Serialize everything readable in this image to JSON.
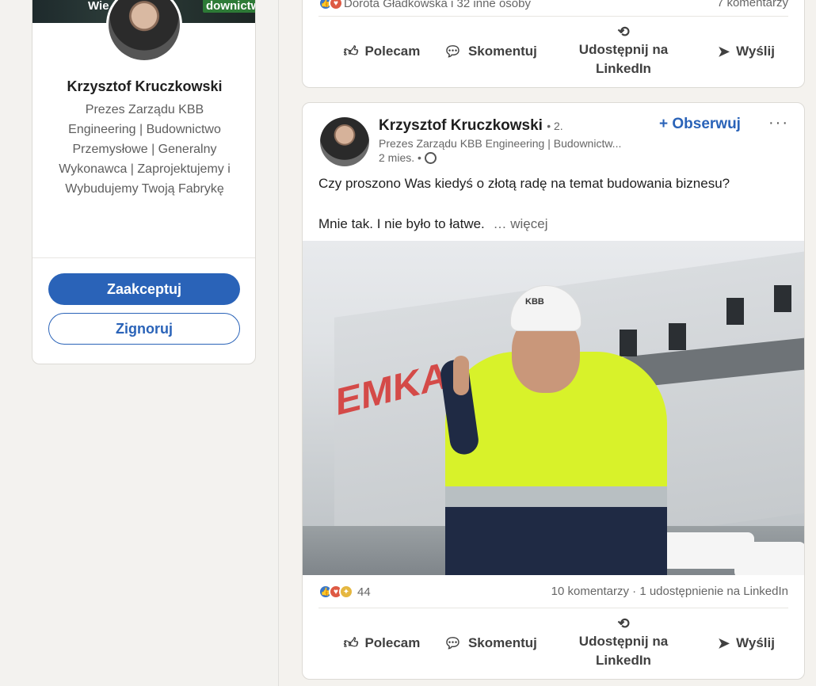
{
  "profile": {
    "banner_left": "Wie",
    "banner_right": "downictwo",
    "name": "Krzysztof Kruczkowski",
    "headline": "Prezes Zarządu KBB Engineering | Budownictwo Przemysłowe | Generalny Wykonawca | Zaprojektujemy i Wybudujemy Twoją Fabrykę",
    "accept_label": "Zaakceptuj",
    "ignore_label": "Zignoruj"
  },
  "post_prev": {
    "reactions_text": "Dorota Gładkowska i 32 inne osoby",
    "comments_text": "7 komentarzy"
  },
  "actions": {
    "like": "Polecam",
    "comment": "Skomentuj",
    "share": "Udostępnij na LinkedIn",
    "send": "Wyślij"
  },
  "post": {
    "author_name": "Krzysztof Kruczkowski",
    "degree": "• 2.",
    "author_headline": "Prezes Zarządu KBB Engineering | Budownictw...",
    "time": "2 mies. •",
    "follow_label": "+ Obserwuj",
    "more_label": "···",
    "text_line1": "Czy proszono Was kiedyś o złotą radę na temat budowania biznesu?",
    "text_line2": "Mnie tak. I nie było to łatwe.",
    "see_more": "… więcej",
    "photo_sign": "EMKA",
    "helmet_text": "KBB",
    "reaction_count": "44",
    "engagement_text": "10 komentarzy · 1 udostępnienie na LinkedIn"
  },
  "colors": {
    "accent": "#2a63b8",
    "background": "#f3f2ef",
    "card": "#ffffff"
  },
  "icons": [
    "thumbs-up-icon",
    "comment-icon",
    "repost-icon",
    "send-icon",
    "globe-icon",
    "more-icon"
  ]
}
